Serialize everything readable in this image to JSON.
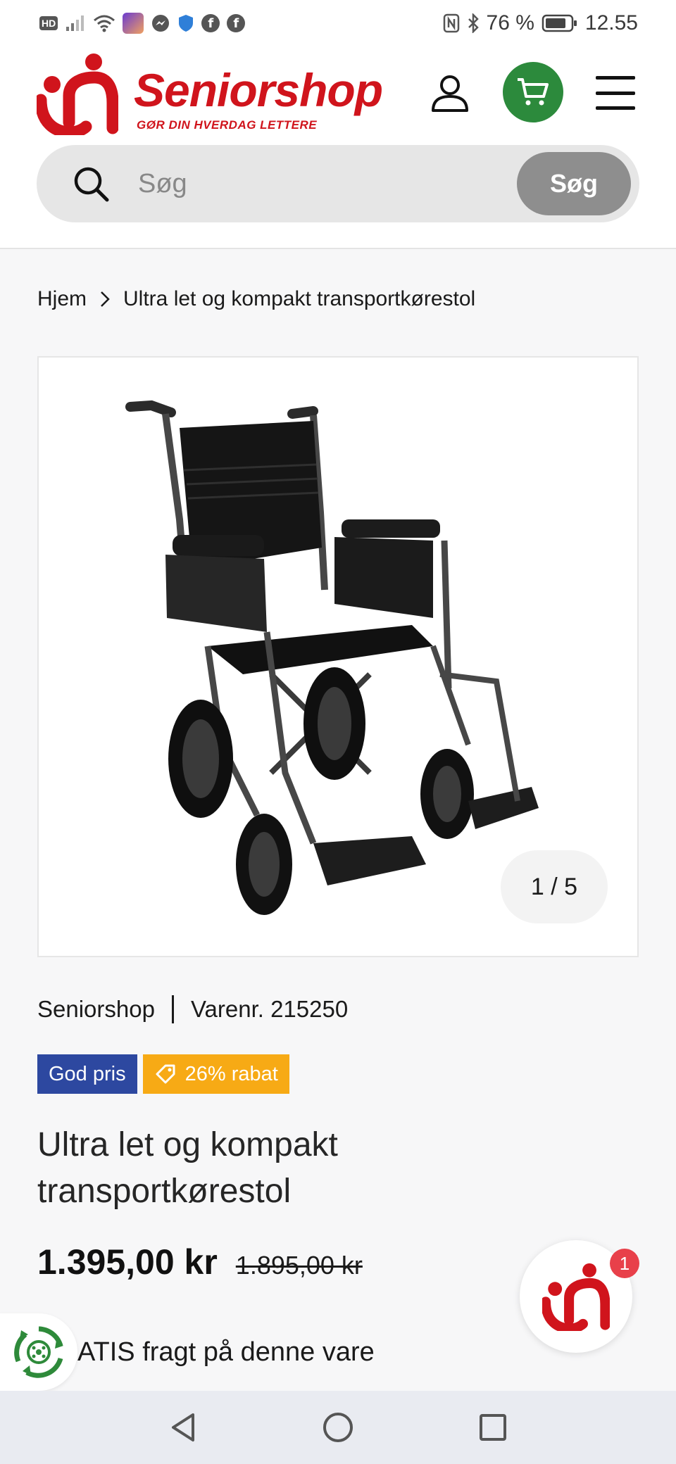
{
  "status_bar": {
    "hd": "HD",
    "battery": "76 %",
    "time": "12.55"
  },
  "header": {
    "brand_name": "Seniorshop",
    "brand_tagline": "GØR DIN HVERDAG LETTERE",
    "accent_color": "#d0141c",
    "cart_color": "#2c8a3c"
  },
  "search": {
    "placeholder": "Søg",
    "button_label": "Søg"
  },
  "breadcrumb": {
    "home": "Hjem",
    "current": "Ultra let og kompakt transportkørestol"
  },
  "gallery": {
    "counter": "1 / 5",
    "image_subject": "wheelchair"
  },
  "product": {
    "brand": "Seniorshop",
    "sku": "Varenr. 215250",
    "badge_good_price": "God pris",
    "badge_discount": "26% rabat",
    "title": "Ultra let og kompakt transportkørestol",
    "price": "1.395,00 kr",
    "old_price": "1.895,00 kr",
    "shipping_text": "ATIS fragt på denne vare"
  },
  "chat": {
    "unread": "1"
  }
}
